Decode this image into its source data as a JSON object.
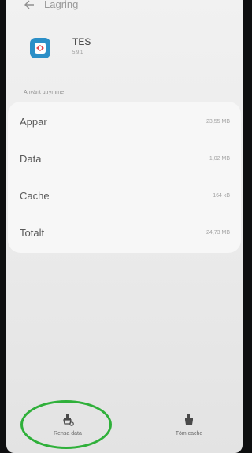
{
  "topbar": {
    "title": "Lagring"
  },
  "app": {
    "name": "TES",
    "version": "5.9.1",
    "icon_color": "#2c8fc7"
  },
  "storage": {
    "section_label": "Använt utrymme",
    "rows": [
      {
        "label": "Appar",
        "value": "23,55 MB"
      },
      {
        "label": "Data",
        "value": "1,02 MB"
      },
      {
        "label": "Cache",
        "value": "164 kB"
      },
      {
        "label": "Totalt",
        "value": "24,73 MB"
      }
    ]
  },
  "actions": {
    "clear_data": {
      "label": "Rensa data",
      "icon": "clear-data-icon"
    },
    "clear_cache": {
      "label": "Töm cache",
      "icon": "clear-cache-icon"
    }
  },
  "annotation": {
    "highlight_color": "#2fb03a"
  }
}
